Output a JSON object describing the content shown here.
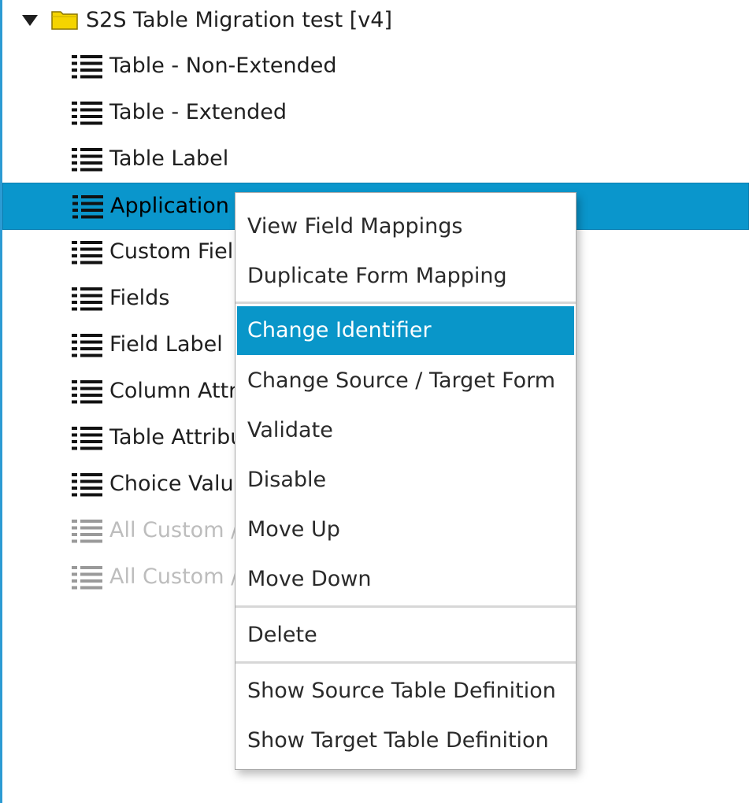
{
  "tree": {
    "root": {
      "label": "S2S Table Migration test [v4]",
      "expander_icon": "triangle-down",
      "icon": "folder-icon",
      "icon_color": "#f5d400"
    },
    "items": [
      {
        "label": "Table - Non-Extended",
        "state": "normal"
      },
      {
        "label": "Table - Extended",
        "state": "normal"
      },
      {
        "label": "Table Label",
        "state": "normal"
      },
      {
        "label": "Application",
        "state": "selected"
      },
      {
        "label": "Custom Fiel",
        "state": "normal"
      },
      {
        "label": "Fields",
        "state": "normal"
      },
      {
        "label": "Field Label",
        "state": "normal"
      },
      {
        "label": "Column Attr",
        "state": "normal"
      },
      {
        "label": "Table Attribu",
        "state": "normal"
      },
      {
        "label": "Choice Valu",
        "state": "normal"
      },
      {
        "label": "All Custom /",
        "state": "disabled"
      },
      {
        "label": "All Custom /",
        "state": "disabled"
      }
    ],
    "item_icon": "list-icon",
    "selection_color": "#0a96cc"
  },
  "context_menu": {
    "items": [
      {
        "label": "View Field Mappings"
      },
      {
        "label": "Duplicate Form Mapping"
      },
      {
        "label": "Change Identifier",
        "highlighted": true
      },
      {
        "label": "Change Source / Target Form"
      },
      {
        "label": "Validate"
      },
      {
        "label": "Disable"
      },
      {
        "label": "Move Up"
      },
      {
        "label": "Move Down"
      },
      {
        "label": "Delete"
      },
      {
        "label": "Show Source Table Definition"
      },
      {
        "label": "Show Target Table Definition"
      }
    ],
    "highlight_color": "#0996c9"
  }
}
